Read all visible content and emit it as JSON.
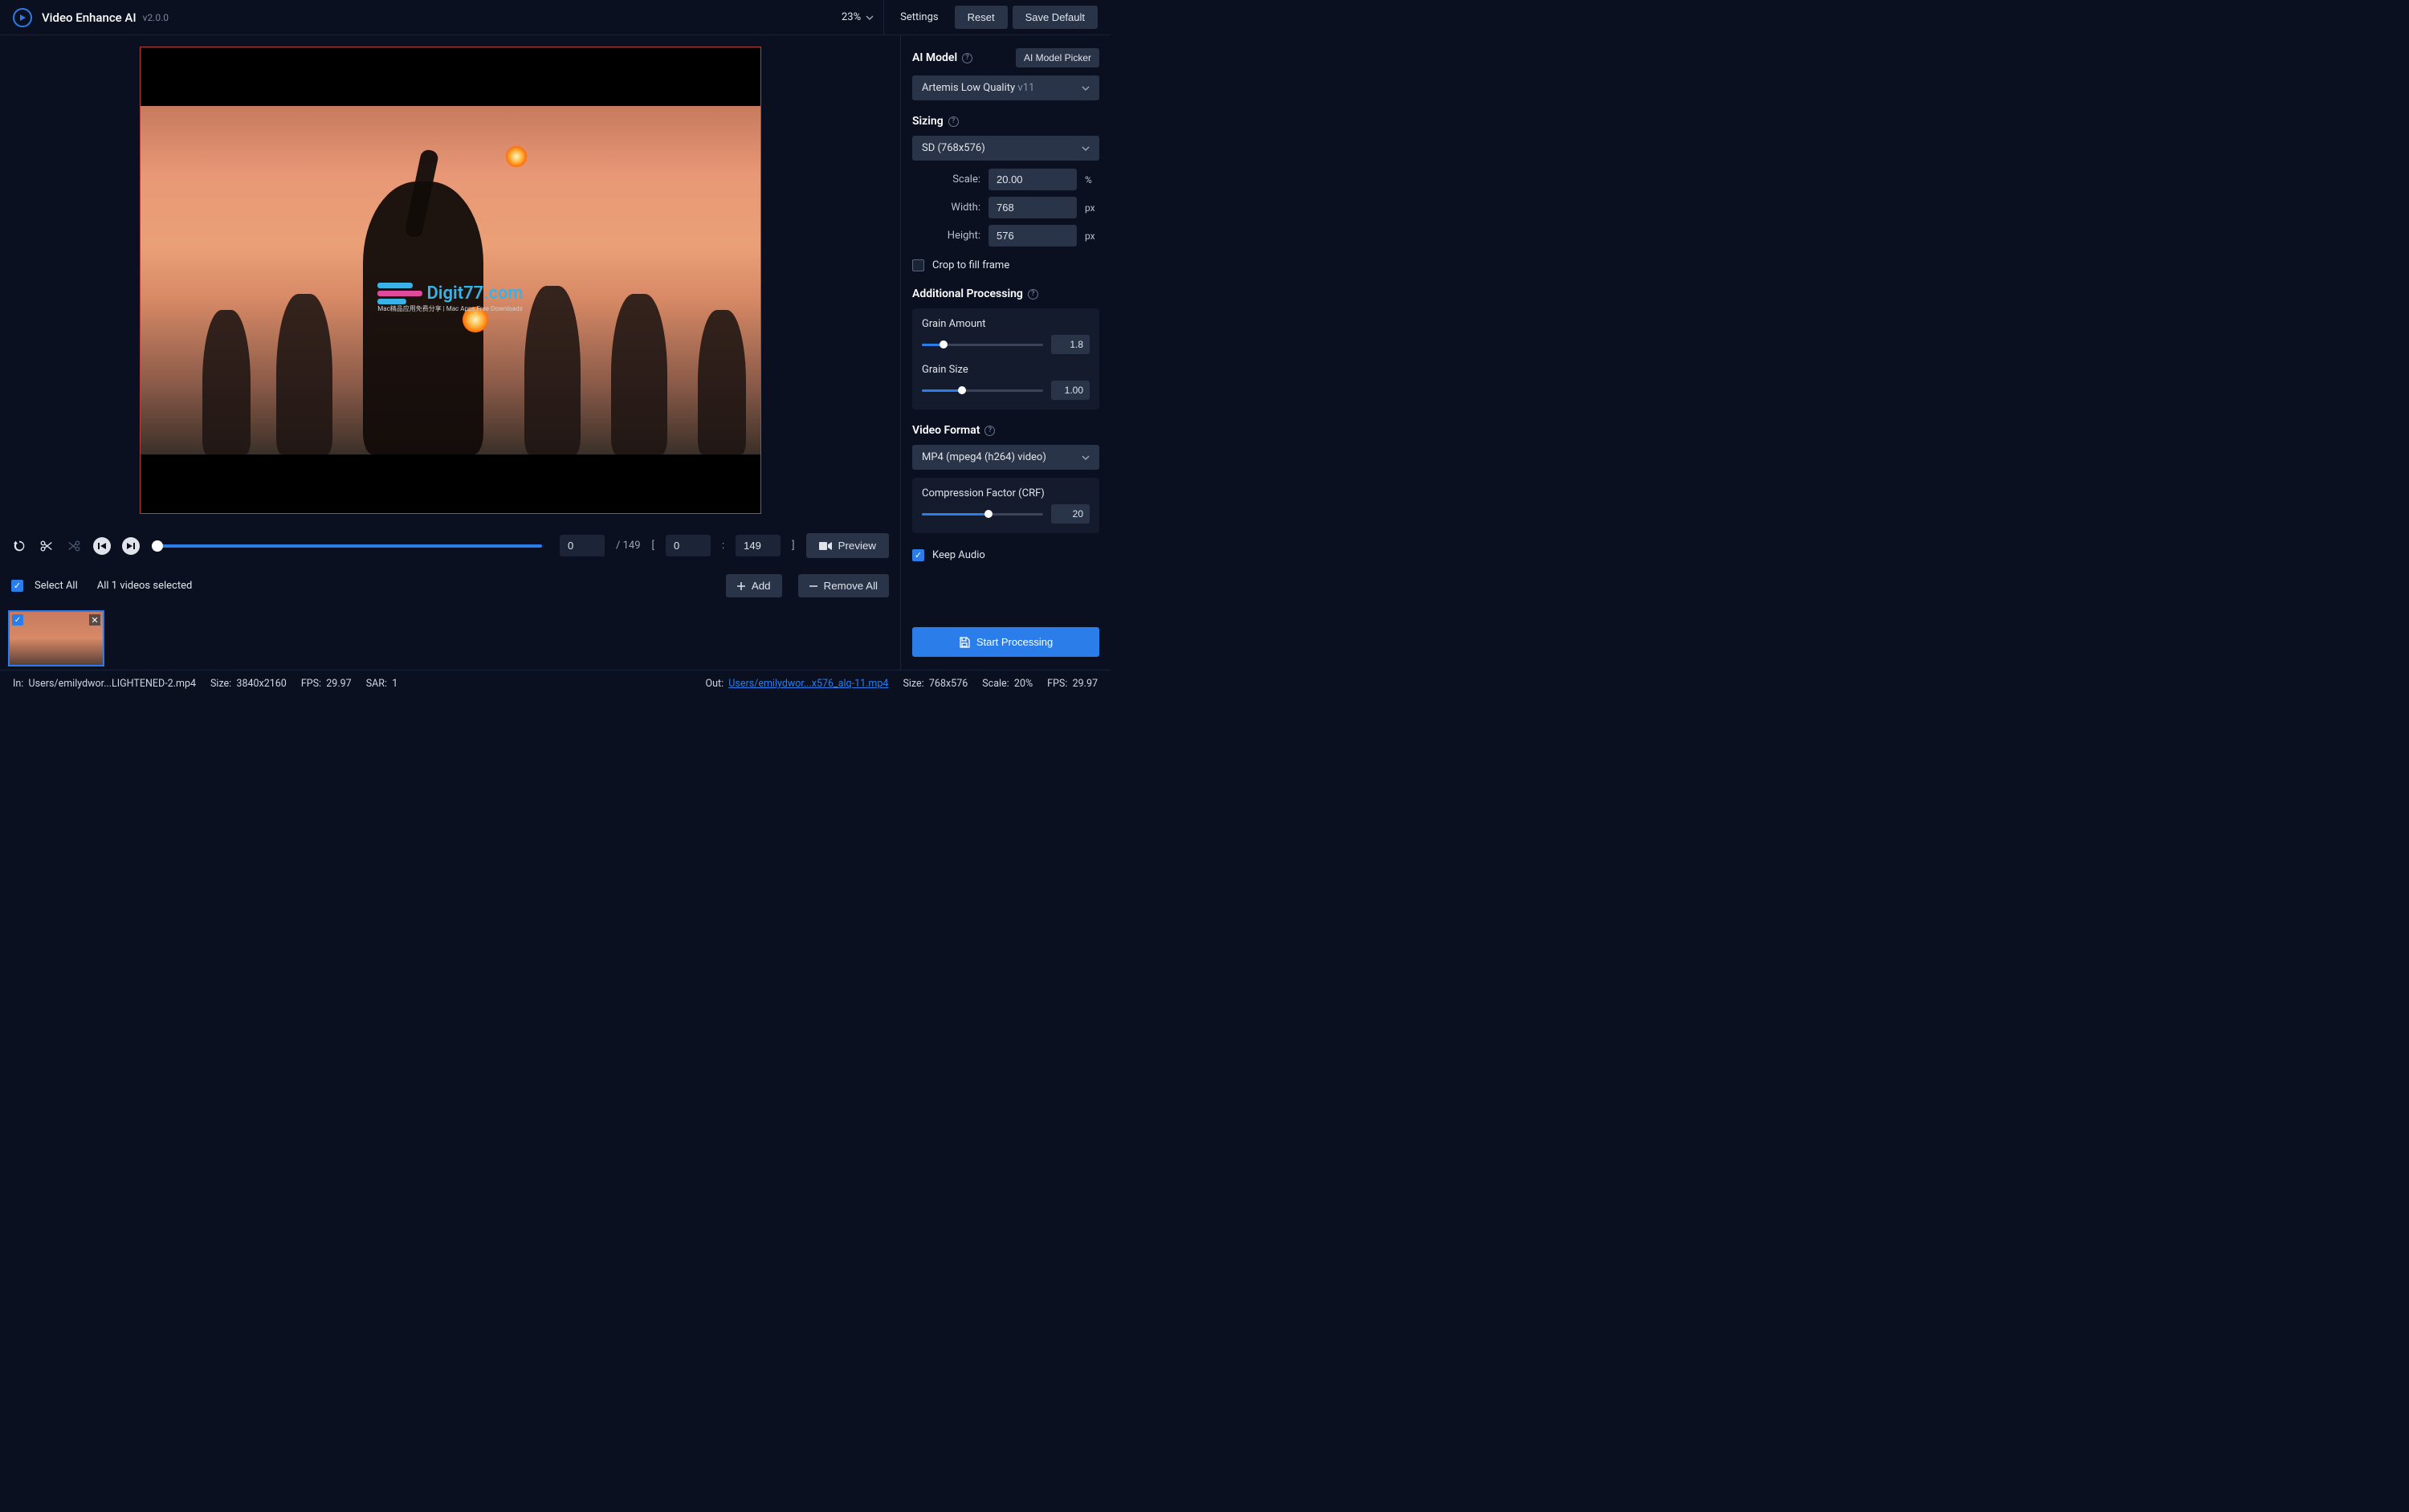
{
  "header": {
    "title": "Video Enhance AI",
    "version": "v2.0.0",
    "zoom": "23%",
    "settings": "Settings",
    "reset": "Reset",
    "save_default": "Save Default"
  },
  "playbar": {
    "current_frame": "0",
    "total_frames": "/ 149",
    "range_start": "0",
    "range_end": "149",
    "preview": "Preview"
  },
  "selection": {
    "select_all": "Select All",
    "count_text": "All 1 videos selected",
    "add": "Add",
    "remove_all": "Remove All"
  },
  "sidebar": {
    "ai_model": {
      "title": "AI Model",
      "picker": "AI Model Picker",
      "selected": "Artemis Low Quality",
      "selected_suffix": "v11"
    },
    "sizing": {
      "title": "Sizing",
      "preset": "SD (768x576)",
      "scale_label": "Scale:",
      "scale_value": "20.00",
      "scale_unit": "%",
      "width_label": "Width:",
      "width_value": "768",
      "height_label": "Height:",
      "height_value": "576",
      "px": "px",
      "crop": "Crop to fill frame"
    },
    "processing": {
      "title": "Additional Processing",
      "grain_amount_label": "Grain Amount",
      "grain_amount_value": "1.8",
      "grain_size_label": "Grain Size",
      "grain_size_value": "1.00"
    },
    "format": {
      "title": "Video Format",
      "selected": "MP4 (mpeg4 (h264) video)",
      "crf_label": "Compression Factor (CRF)",
      "crf_value": "20",
      "keep_audio": "Keep Audio"
    },
    "start": "Start Processing"
  },
  "status": {
    "in_label": "In:",
    "in_path": "Users/emilydwor...LIGHTENED-2.mp4",
    "in_size_label": "Size:",
    "in_size": "3840x2160",
    "in_fps_label": "FPS:",
    "in_fps": "29.97",
    "in_sar_label": "SAR:",
    "in_sar": "1",
    "out_label": "Out:",
    "out_path": "Users/emilydwor...x576_alq-11.mp4",
    "out_size_label": "Size:",
    "out_size": "768x576",
    "out_scale_label": "Scale:",
    "out_scale": "20%",
    "out_fps_label": "FPS:",
    "out_fps": "29.97"
  },
  "watermark": {
    "text": "Digit77.com",
    "sub": "Mac精品应用免费分享 | Mac Apps Free Downloads"
  }
}
